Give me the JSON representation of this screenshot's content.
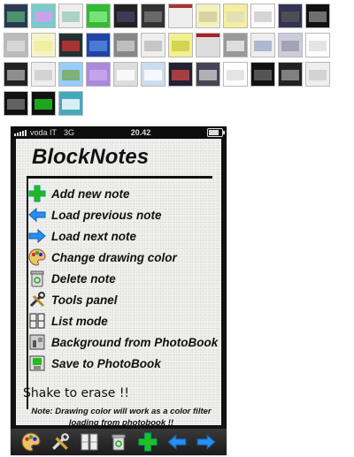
{
  "status_bar": {
    "carrier": "voda IT",
    "network": "3G",
    "time": "20.42"
  },
  "app": {
    "title": "BlockNotes"
  },
  "menu": [
    {
      "label": "Add new note",
      "icon": "plus-icon"
    },
    {
      "label": "Load previous note",
      "icon": "arrow-left-icon"
    },
    {
      "label": "Load next note",
      "icon": "arrow-right-icon"
    },
    {
      "label": "Change drawing color",
      "icon": "palette-icon"
    },
    {
      "label": "Delete note",
      "icon": "trash-icon"
    },
    {
      "label": "Tools panel",
      "icon": "tools-icon"
    },
    {
      "label": "List mode",
      "icon": "list-mode-icon"
    },
    {
      "label": "Background from PhotoBook",
      "icon": "photo-background-icon"
    },
    {
      "label": "Save to PhotoBook",
      "icon": "save-photo-icon"
    }
  ],
  "shake_text": "Shake to erase !!",
  "note_text": "Note: Drawing color will work as a color filter loading from photobook !!",
  "toolbar": [
    "palette-icon",
    "tools-icon",
    "list-mode-icon",
    "trash-icon",
    "plus-icon",
    "arrow-left-icon",
    "arrow-right-icon"
  ],
  "colors": {
    "accent_green": "#2fbf2f",
    "accent_blue": "#2a8df0",
    "toolbar_bg": "#2a2a2a"
  }
}
